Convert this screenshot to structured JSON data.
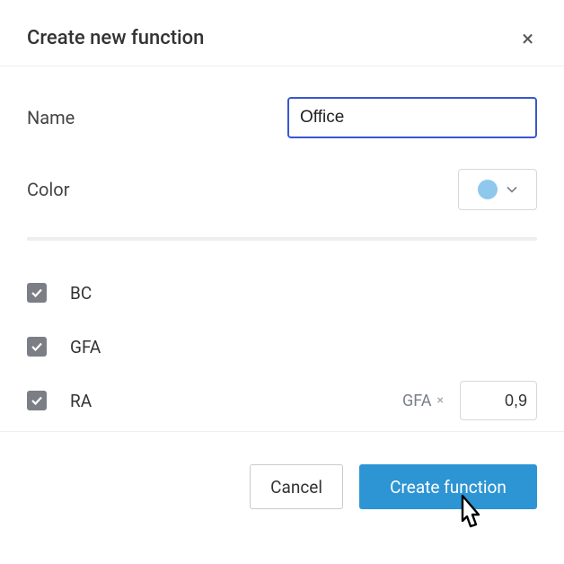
{
  "dialog": {
    "title": "Create new function",
    "close_label": "×"
  },
  "form": {
    "name_label": "Name",
    "name_value": "Office",
    "color_label": "Color",
    "color_value": "#8fc8ec"
  },
  "checks": {
    "items": [
      {
        "label": "BC",
        "checked": true
      },
      {
        "label": "GFA",
        "checked": true
      },
      {
        "label": "RA",
        "checked": true,
        "factor_label": "GFA",
        "factor_value": "0,9"
      }
    ]
  },
  "footer": {
    "cancel": "Cancel",
    "create": "Create function"
  }
}
